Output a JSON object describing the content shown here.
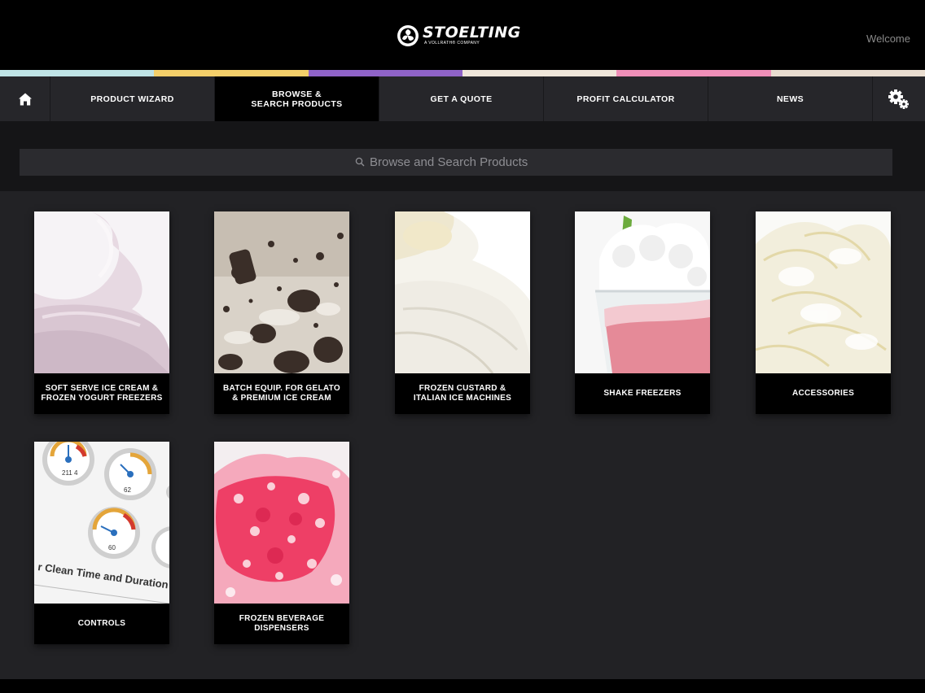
{
  "header": {
    "logo_text": "STOELTING",
    "logo_tagline": "A VOLLRATH® COMPANY",
    "welcome": "Welcome"
  },
  "colors": {
    "strip": [
      "#bfe3e6",
      "#f4cf6a",
      "#8f63c8",
      "#efe6da",
      "#ef8fb8",
      "#e9ddd0"
    ],
    "nav_bg": "#26262a",
    "nav_active": "#000000",
    "content_bg": "#222225"
  },
  "nav": {
    "home_icon": "home-icon",
    "items": [
      {
        "label": "PRODUCT WIZARD",
        "active": false
      },
      {
        "label": "BROWSE &\nSEARCH PRODUCTS",
        "active": true
      },
      {
        "label": "GET A QUOTE",
        "active": false
      },
      {
        "label": "PROFIT CALCULATOR",
        "active": false
      },
      {
        "label": "NEWS",
        "active": false
      }
    ],
    "settings_icon": "gear-icon"
  },
  "search": {
    "placeholder": "Browse and Search Products",
    "icon": "search-icon"
  },
  "categories": [
    {
      "label": "SOFT SERVE ICE CREAM & FROZEN YOGURT FREEZERS",
      "image": "soft-serve-swirl"
    },
    {
      "label": "BATCH EQUIP. FOR GELATO & PREMIUM ICE CREAM",
      "image": "cookies-and-cream"
    },
    {
      "label": "FROZEN CUSTARD & ITALIAN ICE MACHINES",
      "image": "frozen-custard"
    },
    {
      "label": "SHAKE FREEZERS",
      "image": "strawberry-shake"
    },
    {
      "label": "ACCESSORIES",
      "image": "whipped-cream"
    },
    {
      "label": "CONTROLS",
      "image": "control-gauges",
      "gauge_caption": "r Clean Time and Duration",
      "gauge_values": [
        "211 4",
        "62",
        "60"
      ]
    },
    {
      "label": "FROZEN BEVERAGE DISPENSERS",
      "image": "shaved-ice"
    }
  ]
}
